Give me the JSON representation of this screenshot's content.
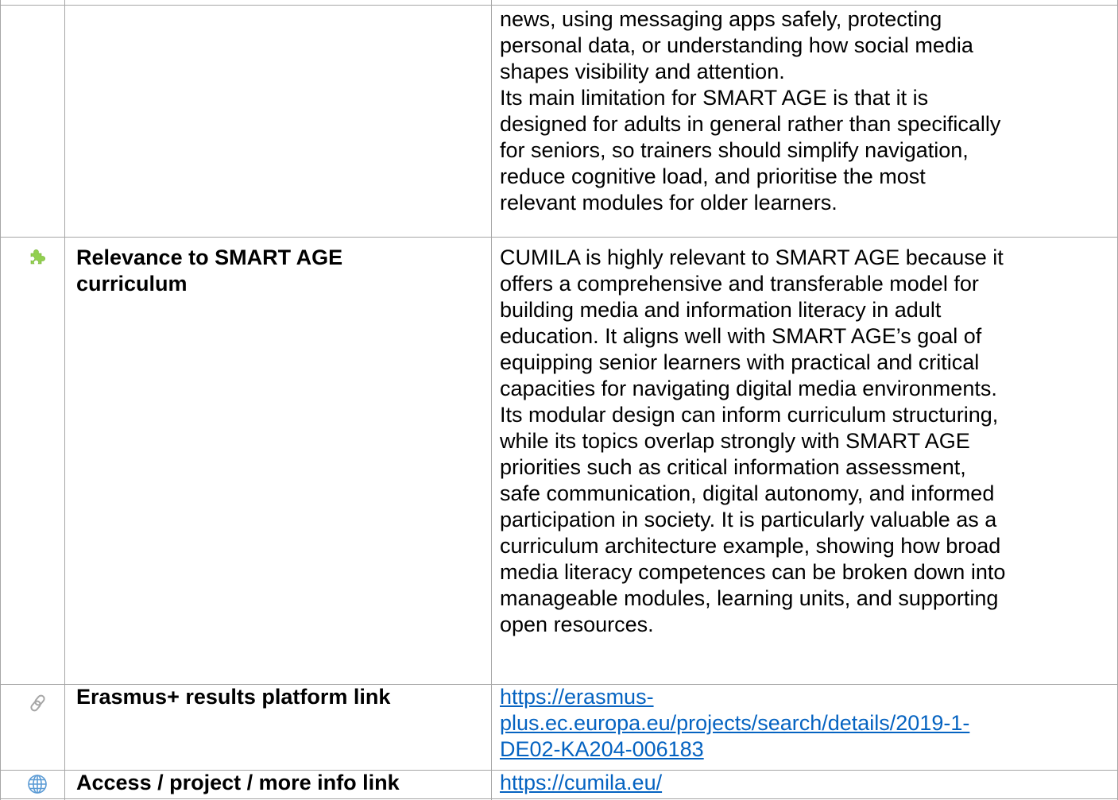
{
  "rows": [
    {
      "paragraphs": [
        [
          "news, using messaging apps safely, protecting",
          "personal data, or understanding how social media",
          "shapes visibility and attention."
        ],
        [
          "Its main limitation for SMART AGE is that it is",
          "designed for adults in general rather than specifically",
          "for seniors, so trainers should simplify navigation,",
          "reduce cognitive load, and prioritise the most",
          "relevant modules for older learners."
        ]
      ]
    },
    {
      "icon": "puzzle-icon",
      "label": [
        "Relevance to SMART AGE",
        "curriculum"
      ],
      "lines": [
        "CUMILA is highly relevant to SMART AGE because it",
        "offers a comprehensive and transferable model for",
        "building media and information literacy in adult",
        "education. It aligns well with SMART AGE’s goal of",
        "equipping senior learners with practical and critical",
        "capacities for navigating digital media environments.",
        "Its modular design can inform curriculum structuring,",
        "while its topics overlap strongly with SMART AGE",
        "priorities such as critical information assessment,",
        "safe communication, digital autonomy, and informed",
        "participation in society. It is particularly valuable as a",
        "curriculum architecture example, showing how broad",
        "media literacy competences can be broken down into",
        "manageable modules, learning units, and supporting",
        "open resources."
      ]
    },
    {
      "icon": "link-icon",
      "label": [
        "Erasmus+ results platform link"
      ],
      "link_lines": [
        "https://erasmus-",
        "plus.ec.europa.eu/projects/search/details/2019-1-",
        "DE02-KA204-006183"
      ]
    },
    {
      "icon": "globe-icon",
      "label": [
        "Access / project / more info link"
      ],
      "link_lines": [
        "https://cumila.eu/"
      ]
    }
  ],
  "colors": {
    "link": "#0563c1",
    "border": "#a6a6a6",
    "puzzle": "#92d050",
    "icon_gray": "#a6a6a6",
    "globe": "#5b9bd5"
  }
}
